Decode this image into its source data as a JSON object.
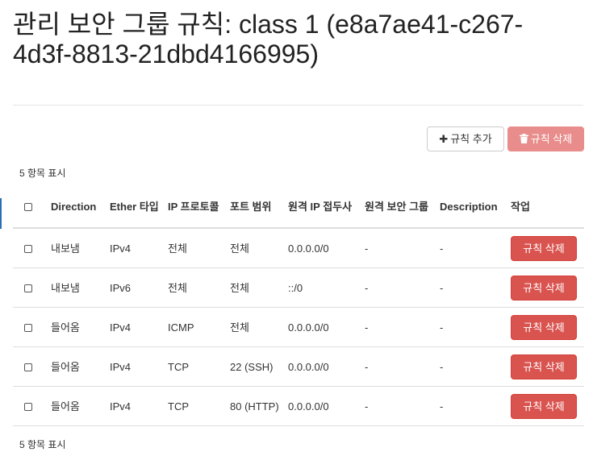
{
  "page": {
    "title": "관리 보안 그룹 규칙: class 1 (e8a7ae41-c267-4d3f-8813-21dbd4166995)"
  },
  "toolbar": {
    "add_rule_label": "규칙 추가",
    "delete_rules_label": "규칙 삭제",
    "add_icon": "plus-icon",
    "delete_icon": "trash-icon"
  },
  "table": {
    "count_top": "5 항목 표시",
    "count_bottom": "5 항목 표시",
    "headers": {
      "direction": "Direction",
      "ether_type": "Ether 타입",
      "ip_protocol": "IP 프로토콜",
      "port_range": "포트 범위",
      "remote_ip_prefix": "원격 IP 접두사",
      "remote_security_group": "원격 보안 그룹",
      "description": "Description",
      "actions": "작업"
    },
    "rows": [
      {
        "direction": "내보냄",
        "ether_type": "IPv4",
        "ip_protocol": "전체",
        "port_range": "전체",
        "remote_ip_prefix": "0.0.0.0/0",
        "remote_security_group": "-",
        "description": "-",
        "action_label": "규칙 삭제"
      },
      {
        "direction": "내보냄",
        "ether_type": "IPv6",
        "ip_protocol": "전체",
        "port_range": "전체",
        "remote_ip_prefix": "::/0",
        "remote_security_group": "-",
        "description": "-",
        "action_label": "규칙 삭제"
      },
      {
        "direction": "들어옴",
        "ether_type": "IPv4",
        "ip_protocol": "ICMP",
        "port_range": "전체",
        "remote_ip_prefix": "0.0.0.0/0",
        "remote_security_group": "-",
        "description": "-",
        "action_label": "규칙 삭제"
      },
      {
        "direction": "들어옴",
        "ether_type": "IPv4",
        "ip_protocol": "TCP",
        "port_range": "22 (SSH)",
        "remote_ip_prefix": "0.0.0.0/0",
        "remote_security_group": "-",
        "description": "-",
        "action_label": "규칙 삭제"
      },
      {
        "direction": "들어옴",
        "ether_type": "IPv4",
        "ip_protocol": "TCP",
        "port_range": "80 (HTTP)",
        "remote_ip_prefix": "0.0.0.0/0",
        "remote_security_group": "-",
        "description": "-",
        "action_label": "규칙 삭제"
      }
    ]
  },
  "colors": {
    "danger": "#d9534f",
    "danger_disabled": "#e88d8b",
    "accent": "#2a6fb5"
  }
}
